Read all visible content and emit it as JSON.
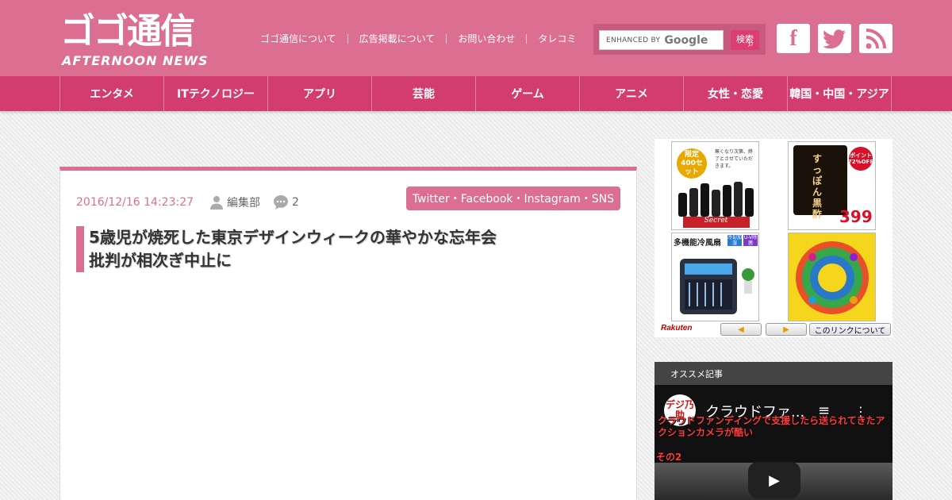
{
  "header": {
    "logo_main": "ゴゴ通信",
    "logo_sub": "AFTERNOON NEWS",
    "links": [
      "ゴゴ通信について",
      "広告掲載について",
      "お問い合わせ",
      "タレコミ"
    ],
    "search": {
      "enhanced": "ENHANCED BY",
      "google": "Google",
      "button": "検索"
    },
    "social": [
      "facebook-icon",
      "twitter-icon",
      "rss-icon"
    ]
  },
  "nav": {
    "items": [
      "エンタメ",
      "ITテクノロジー",
      "アプリ",
      "芸能",
      "ゲーム",
      "アニメ",
      "女性・恋愛",
      "韓国・中国・アジア"
    ]
  },
  "article": {
    "date": "2016/12/16 14:23:27",
    "author": "編集部",
    "comments": "2",
    "tag": "Twitter・Facebook・Instagram・SNS",
    "title_line1": "5歳児が焼死した東京デザインウィークの華やかな忘年会",
    "title_line2": "批判が相次ぎ中止に"
  },
  "ad": {
    "badge1": "限定400セット",
    "p1_note": "無くなり次第、終了とさせていただきます。",
    "p1_label": "Secret",
    "p2_badge": "ポイント72%OFF",
    "p2_name": "すっぽん黒酢",
    "p2_price": "399",
    "p3_title": "多機能冷風扇",
    "p3_tags": [
      "冷却加湿",
      "U-V除菌"
    ],
    "logo": "Rakuten",
    "prev": "◀",
    "next": "▶",
    "about": "このリンクについて"
  },
  "sidebar": {
    "reco_title": "オススメ記事",
    "video_avatar": "デジ乃助",
    "video_title": "クラウドファ...",
    "video_caption": "クラウドファンディングで支援したら送られてきたアクションカメラが酷い",
    "video_caption2": "その2"
  },
  "colors": {
    "brand_pink": "#dc6e92",
    "nav_pink": "#d23c6e"
  }
}
